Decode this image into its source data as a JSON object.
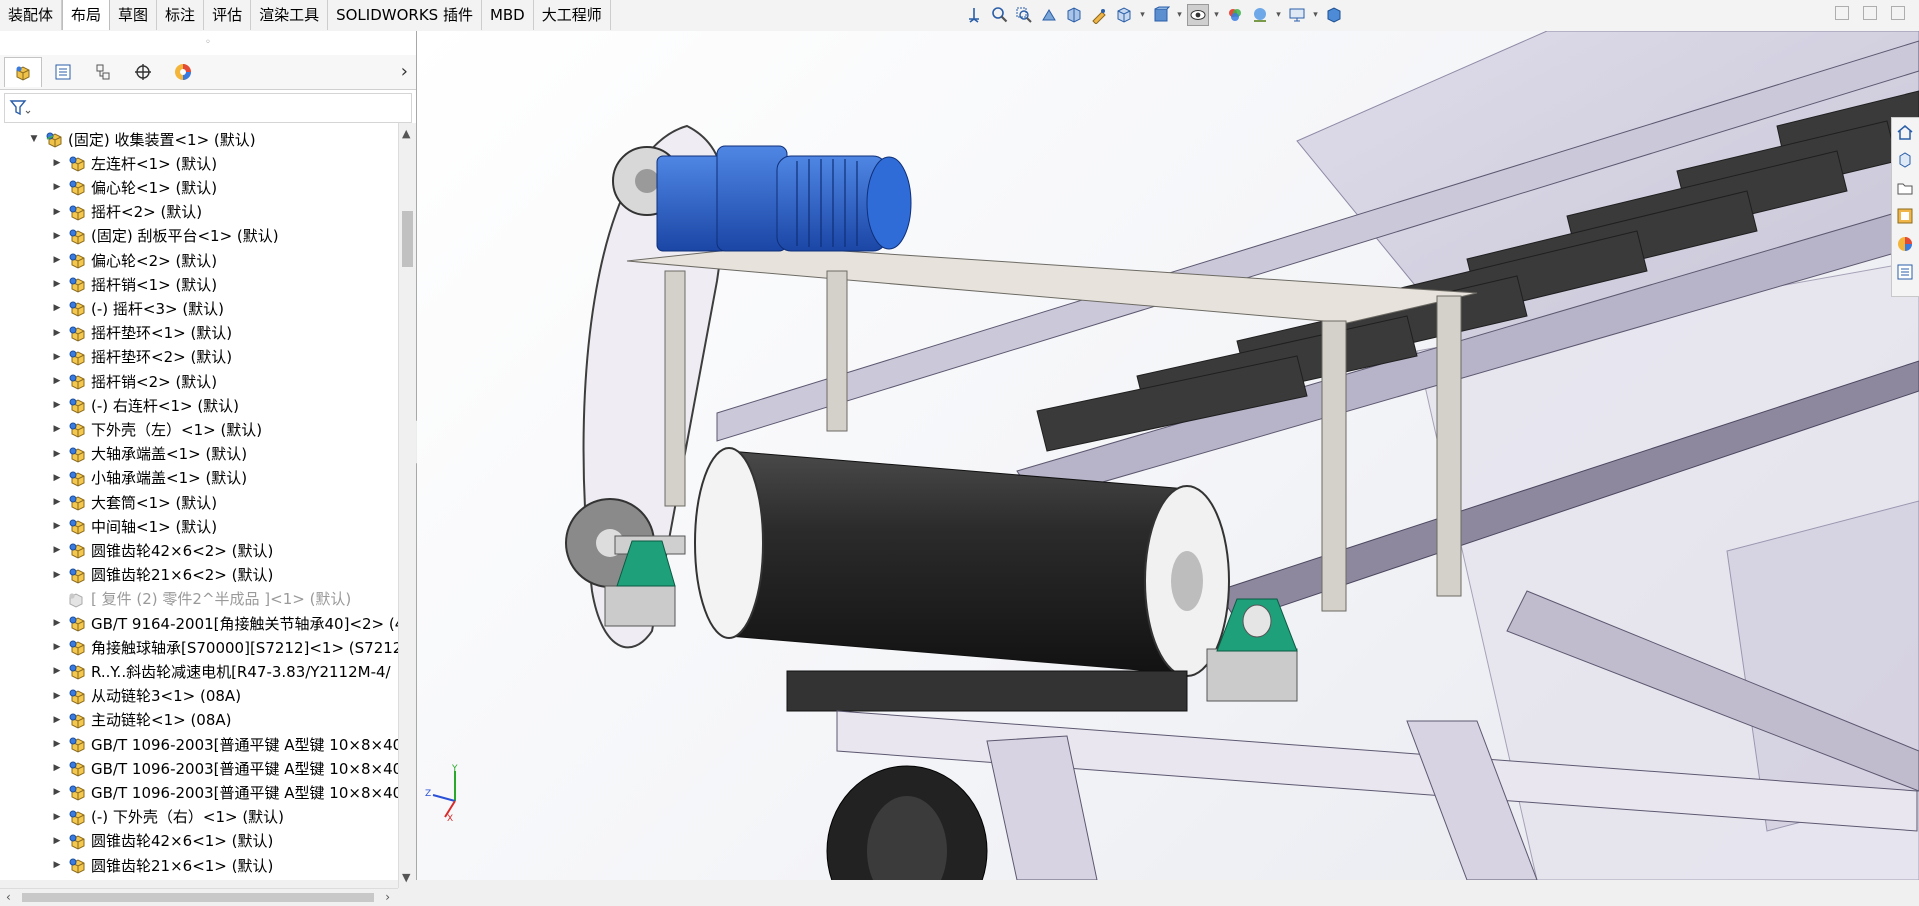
{
  "ribbon": {
    "tabs": [
      {
        "label": "装配体",
        "active": false
      },
      {
        "label": "布局",
        "active": true
      },
      {
        "label": "草图",
        "active": false
      },
      {
        "label": "标注",
        "active": false
      },
      {
        "label": "评估",
        "active": false
      },
      {
        "label": "渲染工具",
        "active": false
      },
      {
        "label": "SOLIDWORKS 插件",
        "active": false
      },
      {
        "label": "MBD",
        "active": false
      },
      {
        "label": "大工程师",
        "active": false
      }
    ],
    "heads_up_icons": [
      "view-orientation-icon",
      "zoom-to-fit-icon",
      "zoom-area-icon",
      "previous-view-icon",
      "section-view-icon",
      "dynamic-annotation-icon",
      "view-orientation-cube-icon",
      "display-style-icon",
      "hide-show-items-icon",
      "edit-appearance-icon",
      "apply-scene-icon",
      "view-settings-icon",
      "display-pane-icon"
    ]
  },
  "feature_manager": {
    "tabs": [
      "featuremanager-tree-icon",
      "property-manager-icon",
      "configuration-manager-icon",
      "dimxpert-manager-icon",
      "display-manager-icon"
    ],
    "rows": [
      {
        "level": 1,
        "expanded": true,
        "label": "(固定) 收集装置<1> (默认)",
        "kind": "assembly"
      },
      {
        "level": 2,
        "label": "左连杆<1> (默认)",
        "kind": "sub"
      },
      {
        "level": 2,
        "label": "偏心轮<1> (默认)",
        "kind": "sub"
      },
      {
        "level": 2,
        "label": "摇杆<2> (默认)",
        "kind": "sub"
      },
      {
        "level": 2,
        "label": "(固定) 刮板平台<1> (默认)",
        "kind": "sub"
      },
      {
        "level": 2,
        "label": "偏心轮<2> (默认)",
        "kind": "sub"
      },
      {
        "level": 2,
        "label": "摇杆销<1> (默认)",
        "kind": "sub"
      },
      {
        "level": 2,
        "label": "(-) 摇杆<3> (默认)",
        "kind": "sub"
      },
      {
        "level": 2,
        "label": "摇杆垫环<1> (默认)",
        "kind": "sub"
      },
      {
        "level": 2,
        "label": "摇杆垫环<2> (默认)",
        "kind": "sub"
      },
      {
        "level": 2,
        "label": "摇杆销<2> (默认)",
        "kind": "sub"
      },
      {
        "level": 2,
        "label": "(-) 右连杆<1> (默认)",
        "kind": "sub"
      },
      {
        "level": 2,
        "label": "下外壳（左）<1> (默认)",
        "kind": "sub"
      },
      {
        "level": 2,
        "label": "大轴承端盖<1> (默认)",
        "kind": "sub"
      },
      {
        "level": 2,
        "label": "小轴承端盖<1> (默认)",
        "kind": "sub"
      },
      {
        "level": 2,
        "label": "大套筒<1> (默认)",
        "kind": "sub"
      },
      {
        "level": 2,
        "label": "中间轴<1> (默认)",
        "kind": "sub"
      },
      {
        "level": 2,
        "label": "圆锥齿轮42×6<2> (默认)",
        "kind": "sub"
      },
      {
        "level": 2,
        "label": "圆锥齿轮21×6<2> (默认)",
        "kind": "sub"
      },
      {
        "level": 2,
        "noarrow": true,
        "suppressed": true,
        "label": "[ 复件 (2) 零件2^半成品 ]<1> (默认)",
        "kind": "suppressed"
      },
      {
        "level": 2,
        "label": "GB/T 9164-2001[角接触关节轴承40]<2> (4",
        "kind": "sub"
      },
      {
        "level": 2,
        "label": "角接触球轴承[S70000][S7212]<1> (S7212)",
        "kind": "sub"
      },
      {
        "level": 2,
        "label": "R..Y..斜齿轮减速电机[R47-3.83/Y2112M-4/",
        "kind": "sub"
      },
      {
        "level": 2,
        "label": "从动链轮3<1> (08A)",
        "kind": "sub"
      },
      {
        "level": 2,
        "label": "主动链轮<1> (08A)",
        "kind": "sub"
      },
      {
        "level": 2,
        "label": "GB/T 1096-2003[普通平键 A型键 10×8×40",
        "kind": "sub"
      },
      {
        "level": 2,
        "label": "GB/T 1096-2003[普通平键 A型键 10×8×40",
        "kind": "sub"
      },
      {
        "level": 2,
        "label": "GB/T 1096-2003[普通平键 A型键 10×8×40",
        "kind": "sub"
      },
      {
        "level": 2,
        "label": "(-) 下外壳（右）<1> (默认)",
        "kind": "sub"
      },
      {
        "level": 2,
        "label": "圆锥齿轮42×6<1> (默认)",
        "kind": "sub"
      },
      {
        "level": 2,
        "label": "圆锥齿轮21×6<1> (默认)",
        "kind": "sub"
      }
    ]
  },
  "triad": {
    "x": "X",
    "y": "Y",
    "z": "Z"
  },
  "task_pane_icons": [
    "home-icon",
    "design-library-icon",
    "file-explorer-icon",
    "view-palette-icon",
    "appearances-icon",
    "custom-properties-icon"
  ]
}
